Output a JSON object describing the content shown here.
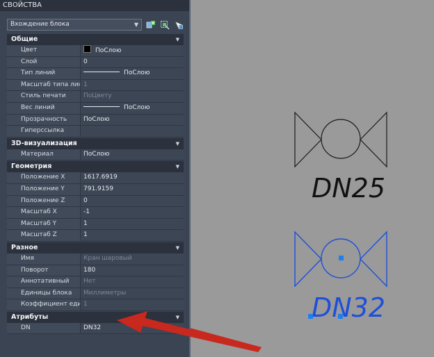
{
  "titlebar": {
    "title": "СВОЙСТВА"
  },
  "selector": {
    "value": "Вхождение блока"
  },
  "toolbar": {
    "icons": [
      "quick-select-icon",
      "select-objects-icon",
      "pickadd-icon"
    ]
  },
  "sections": {
    "general": {
      "title": "Общие",
      "rows": [
        {
          "name": "Цвет",
          "value": "ПоСлою"
        },
        {
          "name": "Слой",
          "value": "0"
        },
        {
          "name": "Тип линий",
          "value": "ПоСлою"
        },
        {
          "name": "Масштаб типа линий",
          "value": "1"
        },
        {
          "name": "Стиль печати",
          "value": "ПоЦвету"
        },
        {
          "name": "Вес линий",
          "value": "ПоСлою"
        },
        {
          "name": "Прозрачность",
          "value": "ПоСлою"
        },
        {
          "name": "Гиперссылка",
          "value": ""
        }
      ]
    },
    "viz3d": {
      "title": "3D-визуализация",
      "rows": [
        {
          "name": "Материал",
          "value": "ПоСлою"
        }
      ]
    },
    "geometry": {
      "title": "Геометрия",
      "rows": [
        {
          "name": "Положение X",
          "value": "1617.6919"
        },
        {
          "name": "Положение Y",
          "value": "791.9159"
        },
        {
          "name": "Положение Z",
          "value": "0"
        },
        {
          "name": "Масштаб X",
          "value": "-1"
        },
        {
          "name": "Масштаб Y",
          "value": "1"
        },
        {
          "name": "Масштаб Z",
          "value": "1"
        }
      ]
    },
    "misc": {
      "title": "Разное",
      "rows": [
        {
          "name": "Имя",
          "value": "Кран шаровый"
        },
        {
          "name": "Поворот",
          "value": "180"
        },
        {
          "name": "Аннотативный",
          "value": "Нет"
        },
        {
          "name": "Единицы блока",
          "value": "Миллиметры"
        },
        {
          "name": "Коэффициент единиц",
          "value": "1"
        }
      ]
    },
    "attributes": {
      "title": "Атрибуты",
      "rows": [
        {
          "name": "DN",
          "value": "DN32"
        }
      ]
    }
  },
  "drawing": {
    "valve1_label": "DN25",
    "valve2_label": "DN32",
    "selection_color": "#1e4fd8",
    "arrow_color": "#c8281e"
  }
}
